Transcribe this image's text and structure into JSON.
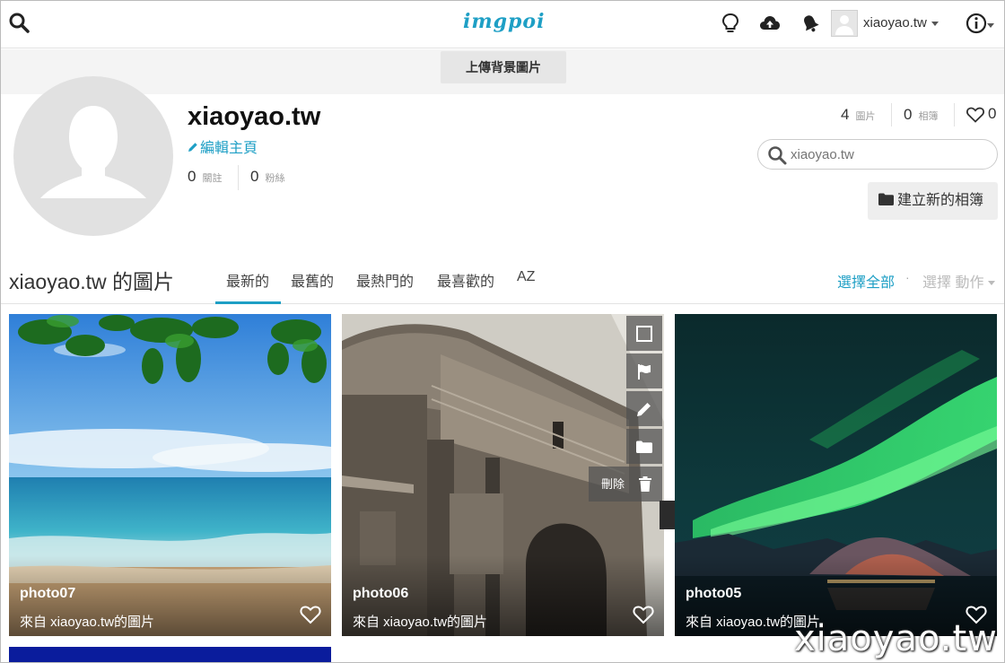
{
  "nav": {
    "logo": "imgpoi",
    "username": "xiaoyao.tw",
    "icons": [
      "search-icon",
      "lightbulb-icon",
      "cloud-upload-icon",
      "bell-icon",
      "user-avatar",
      "info-icon"
    ]
  },
  "cover": {
    "upload_bg_label": "上傳背景圖片"
  },
  "profile": {
    "name": "xiaoyao.tw",
    "edit_label": "編輯主頁",
    "following_count": "0",
    "following_label": "關註",
    "followers_count": "0",
    "followers_label": "粉絲",
    "images_count": "4",
    "images_label": "圖片",
    "albums_count": "0",
    "albums_label": "相簿",
    "likes_count": "0",
    "search_placeholder": "xiaoyao.tw",
    "new_album_label": "建立新的相簿"
  },
  "gallery": {
    "title": "xiaoyao.tw 的圖片",
    "tabs": [
      "最新的",
      "最舊的",
      "最熱門的",
      "最喜歡的",
      "AZ"
    ],
    "active_tab": 0,
    "select_all": "選擇全部",
    "select_sep": "·",
    "select_action": "選擇 動作",
    "delete_label": "刪除",
    "items": [
      {
        "title": "photo07",
        "source": "來自 xiaoyao.tw的圖片"
      },
      {
        "title": "photo06",
        "source": "來自 xiaoyao.tw的圖片"
      },
      {
        "title": "photo05",
        "source": "來自 xiaoyao.tw的圖片"
      }
    ]
  },
  "watermark": "xiaoyao.tw",
  "colors": {
    "accent": "#1e9fc5"
  }
}
